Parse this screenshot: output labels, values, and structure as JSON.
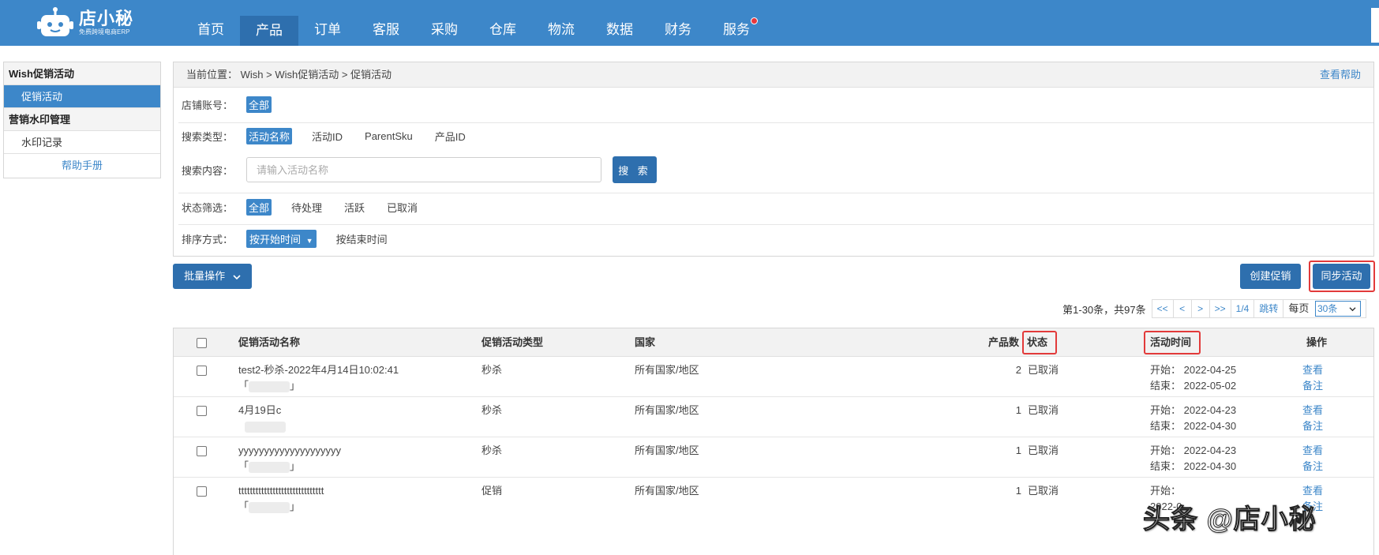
{
  "app": {
    "logo_name": "店小秘",
    "logo_tagline": "免费跨境电商ERP"
  },
  "nav": {
    "items": [
      "首页",
      "产品",
      "订单",
      "客服",
      "采购",
      "仓库",
      "物流",
      "数据",
      "财务",
      "服务"
    ],
    "active": "产品"
  },
  "sidebar": {
    "groups": [
      {
        "title": "Wish促销活动",
        "items": [
          "促销活动"
        ]
      },
      {
        "title": "营销水印管理",
        "items": [
          "水印记录"
        ]
      }
    ],
    "active_item": "促销活动",
    "help": "帮助手册"
  },
  "breadcrumb": {
    "text": "当前位置：  Wish > Wish促销活动 > 促销活动",
    "help_link": "查看帮助"
  },
  "filters": {
    "shop_label": "店铺账号：",
    "shop_options": [
      "全部"
    ],
    "search_type_label": "搜索类型：",
    "search_type_options": [
      "活动名称",
      "活动ID",
      "ParentSku",
      "产品ID"
    ],
    "search_content_label": "搜索内容：",
    "search_placeholder": "请输入活动名称",
    "search_button": "搜 索",
    "status_label": "状态筛选：",
    "status_options": [
      "全部",
      "待处理",
      "活跃",
      "已取消"
    ],
    "sort_label": "排序方式：",
    "sort_selected": "按开始时间",
    "sort_other": "按结束时间"
  },
  "toolbar": {
    "batch": "批量操作",
    "create": "创建促销",
    "sync": "同步活动"
  },
  "pagination": {
    "info": "第1-30条，共97条",
    "first": "<<",
    "prev": "<",
    "next": ">",
    "last": ">>",
    "page": "1/4",
    "jump": "跳转",
    "per_page_label": "每页",
    "per_page": "30条"
  },
  "table": {
    "headers": {
      "name": "促销活动名称",
      "type": "促销活动类型",
      "country": "国家",
      "count": "产品数",
      "status": "状态",
      "time": "活动时间",
      "action": "操作"
    },
    "rows": [
      {
        "name": "test2-秒杀-2022年4月14日10:02:41",
        "shop_open": "「",
        "shop_close": "」",
        "type": "秒杀",
        "country": "所有国家/地区",
        "count": "2",
        "status": "已取消",
        "start": "开始：  2022-04-25",
        "end": "结束：  2022-05-02",
        "view": "查看",
        "note": "备注"
      },
      {
        "name": "4月19日c",
        "shop_open": "",
        "shop_close": "",
        "type": "秒杀",
        "country": "所有国家/地区",
        "count": "1",
        "status": "已取消",
        "start": "开始：  2022-04-23",
        "end": "结束：  2022-04-30",
        "view": "查看",
        "note": "备注"
      },
      {
        "name": "yyyyyyyyyyyyyyyyyyyy",
        "shop_open": "「",
        "shop_close": "」",
        "type": "秒杀",
        "country": "所有国家/地区",
        "count": "1",
        "status": "已取消",
        "start": "开始：  2022-04-23",
        "end": "结束：  2022-04-30",
        "view": "查看",
        "note": "备注"
      },
      {
        "name": "tttttttttttttttttttttttttttttt",
        "shop_open": "「",
        "shop_close": "」",
        "type": "促销",
        "country": "所有国家/地区",
        "count": "1",
        "status": "已取消",
        "start": "开始：",
        "end": "2022-0",
        "view": "查看",
        "note": "备注"
      }
    ]
  },
  "watermark": "头条 @店小秘",
  "colors": {
    "brand": "#3d87c9",
    "brand_dark": "#2e6fae",
    "highlight_frame": "#e23a3a"
  }
}
